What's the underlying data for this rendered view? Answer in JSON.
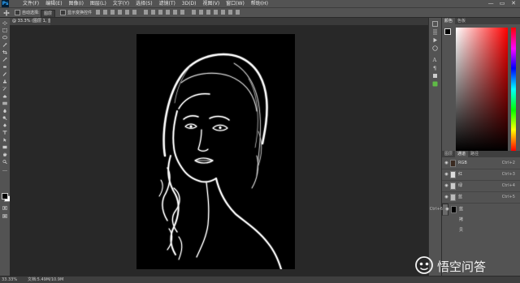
{
  "app": {
    "logo": "Ps"
  },
  "menu": [
    "文件(F)",
    "编辑(E)",
    "图像(I)",
    "图层(L)",
    "文字(Y)",
    "选择(S)",
    "滤镜(T)",
    "3D(D)",
    "视图(V)",
    "窗口(W)",
    "帮助(H)"
  ],
  "window_controls": [
    "—",
    "▭",
    "✕"
  ],
  "options_bar": {
    "auto_select_label": "自动选择:",
    "auto_select_value": "图层",
    "show_transform_label": "显示变换控件"
  },
  "document_tab": {
    "title": "@ 33.3% (图层 1, 蓝色/8)"
  },
  "panels": {
    "color_tabs": [
      "颜色",
      "色板"
    ],
    "lower_tabs": [
      "图层",
      "通道",
      "路径"
    ],
    "active_lower_tab": "通道",
    "channels": [
      {
        "name": "RGB",
        "shortcut": "Ctrl+2",
        "visible": true,
        "selected": false
      },
      {
        "name": "红",
        "shortcut": "Ctrl+3",
        "visible": true,
        "selected": false
      },
      {
        "name": "绿",
        "shortcut": "Ctrl+4",
        "visible": true,
        "selected": false
      },
      {
        "name": "蓝",
        "shortcut": "Ctrl+5",
        "visible": true,
        "selected": false
      },
      {
        "name": "蓝 拷贝",
        "shortcut": "Ctrl+6",
        "visible": true,
        "selected": true
      }
    ]
  },
  "status": {
    "zoom": "33.33%",
    "doc_info": "文档:5.49M/10.9M"
  },
  "watermark": {
    "text": "悟空问答"
  },
  "colors": {
    "accent": "#31a8ff",
    "panel": "#535353",
    "canvas_bg": "#282828"
  }
}
